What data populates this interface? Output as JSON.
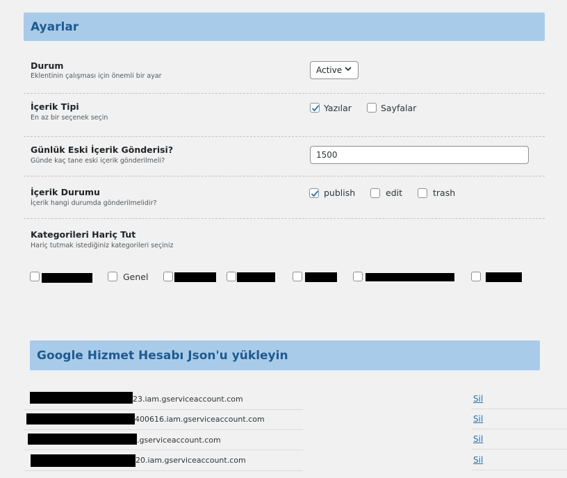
{
  "settings": {
    "title": "Ayarlar",
    "durum": {
      "label": "Durum",
      "desc": "Eklentinin çalışması için önemli bir ayar",
      "value": "Active"
    },
    "icerik_tipi": {
      "label": "İçerik Tipi",
      "desc": "En az bir seçenek seçin",
      "options": [
        {
          "label": "Yazılar",
          "checked": true
        },
        {
          "label": "Sayfalar",
          "checked": false
        }
      ]
    },
    "gunluk": {
      "label": "Günlük Eski İçerik Gönderisi?",
      "desc": "Günde kaç tane eski içerik gönderilmeli?",
      "value": "1500"
    },
    "icerik_durumu": {
      "label": "İçerik Durumu",
      "desc": "İçerik hangi durumda gönderilmelidir?",
      "options": [
        {
          "label": "publish",
          "checked": true
        },
        {
          "label": "edit",
          "checked": false
        },
        {
          "label": "trash",
          "checked": false
        }
      ]
    },
    "kategoriler": {
      "label": "Kategorileri Hariç Tut",
      "desc": "Hariç tutmak istediğiniz kategorileri seçiniz",
      "visible_option": "Genel"
    }
  },
  "google": {
    "title": "Google Hizmet Hesabı Json'u yükleyin",
    "accounts": [
      {
        "suffix": "23.iam.gserviceaccount.com",
        "action": "Sil"
      },
      {
        "suffix": "400616.iam.gserviceaccount.com",
        "action": "Sil"
      },
      {
        "suffix": ".gserviceaccount.com",
        "action": "Sil"
      },
      {
        "suffix": "20.iam.gserviceaccount.com",
        "action": "Sil"
      }
    ]
  },
  "icons": {
    "checkmark": "checkmark-icon",
    "dropdown": "chevron-down-icon"
  },
  "colors": {
    "header_bg": "#a9cbea",
    "header_text": "#1e5a8e",
    "link": "#2271b1",
    "checkmark": "#2271b1"
  }
}
